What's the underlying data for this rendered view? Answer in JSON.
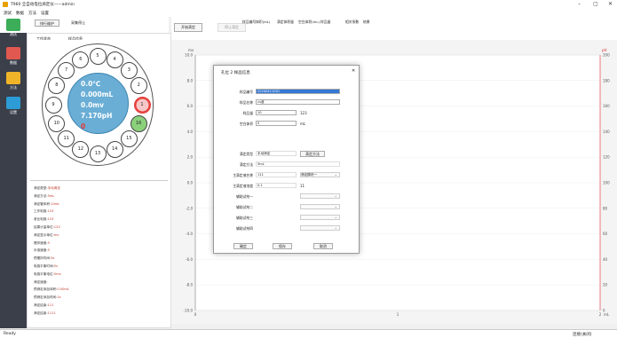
{
  "window": {
    "title": "T960 全自动电位滴定仪——admin",
    "minimize": "–",
    "maximize": "▢",
    "close": "✕"
  },
  "menu": [
    "测试",
    "数据",
    "方法",
    "设置"
  ],
  "toolbar": {
    "flush": "排行维护",
    "pause": "采集停止",
    "start": "开始滴定",
    "stop": "停止滴定"
  },
  "tabs": [
    "工作状态",
    "样品信息"
  ],
  "sidebar": [
    {
      "label": "测试",
      "color": "#3cae5a"
    },
    {
      "label": "数据",
      "color": "#e0584f"
    },
    {
      "label": "方法",
      "color": "#f0b429"
    },
    {
      "label": "设置",
      "color": "#2d9bd6"
    }
  ],
  "dial": {
    "positions": [
      "1",
      "2",
      "3",
      "4",
      "5",
      "6",
      "7",
      "8",
      "9",
      "10",
      "11",
      "12",
      "13",
      "14",
      "15",
      "16"
    ],
    "temp": "0.0℃",
    "volume": "0.000mL",
    "mv": "0.0mv",
    "ph": "7.170pH",
    "count": "0"
  },
  "info_rows": [
    {
      "k": "滴定类型:",
      "v": "手动滴定"
    },
    {
      "k": "滴定方法:",
      "v": "5mL"
    },
    {
      "k": "滴定管体积:",
      "v": "10mL"
    },
    {
      "k": "工作电极:",
      "v": "123"
    },
    {
      "k": "参比电极:",
      "v": "123"
    },
    {
      "k": "结果计量单位:",
      "v": "123"
    },
    {
      "k": "滴定显示单位:",
      "v": "mv"
    },
    {
      "k": "搅拌速度:",
      "v": "5"
    },
    {
      "k": "补液速度:",
      "v": "5"
    },
    {
      "k": "预搅拌时间:",
      "v": "5s"
    },
    {
      "k": "电极平衡时间:",
      "v": "5s"
    },
    {
      "k": "电极平衡电位:",
      "v": "5mv"
    },
    {
      "k": "滴定速度:",
      "v": ""
    },
    {
      "k": "预滴定添加体积:",
      "v": "0.00mL"
    },
    {
      "k": "预滴定添加时间:",
      "v": "1s"
    },
    {
      "k": "滴定结束:",
      "v": "111"
    },
    {
      "k": "滴定结束:",
      "v": "1111"
    }
  ],
  "table_headers": [
    "样品编号",
    "体积(mL)",
    "滴定体积量",
    "空白体积(mL)",
    "样品量",
    "相关系数",
    "结果"
  ],
  "chart": {
    "y_left_ticks": [
      "10.0",
      "8.0",
      "6.0",
      "4.0",
      "2.0",
      "0.0",
      "-2.0",
      "-4.0",
      "-6.0",
      "-8.0",
      "-10.0"
    ],
    "y_left_unit": "mv",
    "y_right_unit": "pH",
    "x_unit": "mL",
    "y_right_ticks": [
      "200",
      "180",
      "160",
      "140",
      "120",
      "100",
      "80",
      "60",
      "40",
      "20",
      "0"
    ],
    "x_ticks": [
      "0",
      "1",
      "2"
    ]
  },
  "dialog": {
    "title": "孔位 2 样品信息",
    "close": "✕",
    "sample_no_label": "样品编号",
    "sample_no": "20240411001",
    "sample_name_label": "样品名称",
    "sample_name": "cs液",
    "amount_label": "样品量",
    "amount": "10",
    "amount_unit": "123",
    "blank_label": "空白体积",
    "blank": "0",
    "blank_unit": "mL",
    "type_label": "滴定类型",
    "type": "手动滴定",
    "method_btn": "滴定方法",
    "method_label": "滴定方法",
    "method": "5mL",
    "main_reagent_label": "主滴定液名称",
    "main_reagent": "111",
    "reagent_select": "滴定模块一",
    "main_conc_label": "主滴定液浓度",
    "main_conc": "0.1",
    "main_conc_unit": "11",
    "aux1": "辅助试剂一",
    "aux2": "辅助试剂二",
    "aux3": "辅助试剂三",
    "aux4": "辅助试剂四",
    "confirm": "确定",
    "save": "保存",
    "cancel": "取消"
  },
  "status": {
    "left": "Ready",
    "right": "连接(关闭)"
  }
}
